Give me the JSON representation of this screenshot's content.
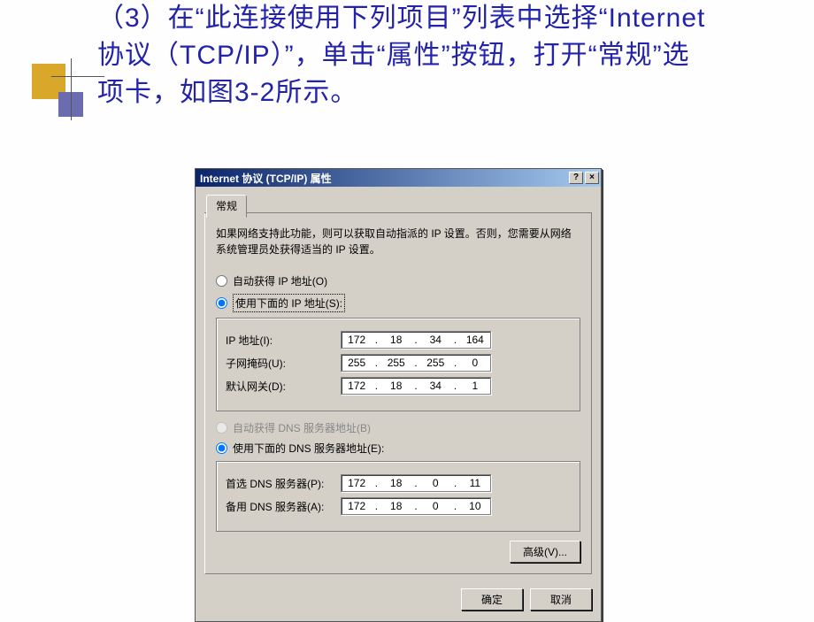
{
  "slide": {
    "text": "（3）在“此连接使用下列项目”列表中选择“Internet协议（TCP/IP）”，单击“属性”按钮，打开“常规”选项卡，如图3-2所示。"
  },
  "dialog": {
    "title": "Internet 协议 (TCP/IP) 属性",
    "help_btn": "?",
    "close_btn": "×",
    "tab_label": "常规",
    "info_text": "如果网络支持此功能，则可以获取自动指派的 IP 设置。否则，您需要从网络系统管理员处获得适当的 IP 设置。",
    "ip_group": {
      "auto_label": "自动获得 IP 地址(O)",
      "manual_label": "使用下面的 IP 地址(S):",
      "selected": "manual",
      "fields": {
        "ip_label": "IP 地址(I):",
        "ip_value": [
          "172",
          "18",
          "34",
          "164"
        ],
        "mask_label": "子网掩码(U):",
        "mask_value": [
          "255",
          "255",
          "255",
          "0"
        ],
        "gw_label": "默认网关(D):",
        "gw_value": [
          "172",
          "18",
          "34",
          "1"
        ]
      }
    },
    "dns_group": {
      "auto_label": "自动获得 DNS 服务器地址(B)",
      "auto_disabled": true,
      "manual_label": "使用下面的 DNS 服务器地址(E):",
      "selected": "manual",
      "fields": {
        "pref_label": "首选 DNS 服务器(P):",
        "pref_value": [
          "172",
          "18",
          "0",
          "11"
        ],
        "alt_label": "备用 DNS 服务器(A):",
        "alt_value": [
          "172",
          "18",
          "0",
          "10"
        ]
      }
    },
    "advanced_btn": "高级(V)...",
    "ok_btn": "确定",
    "cancel_btn": "取消"
  }
}
